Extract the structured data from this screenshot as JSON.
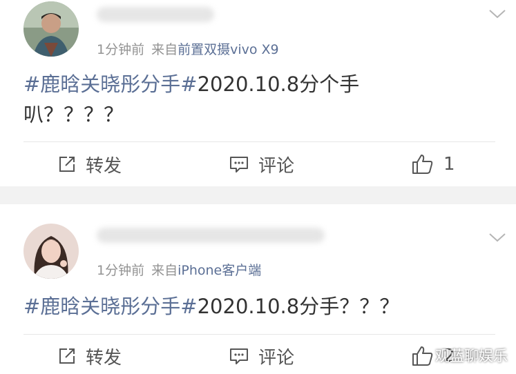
{
  "posts": [
    {
      "time": "1分钟前",
      "source_prefix": "来自",
      "source": "前置双摄vivo X9",
      "hashtag": "#鹿晗关晓彤分手#",
      "text_line1": "2020.10.8分个手",
      "text_line2": "叭？？？？",
      "forward_label": "转发",
      "comment_label": "评论",
      "like_count": "1"
    },
    {
      "time": "1分钟前",
      "source_prefix": "来自",
      "source": "iPhone客户端",
      "hashtag": "#鹿晗关晓彤分手#",
      "text": "2020.10.8分手？？？",
      "forward_label": "转发",
      "comment_label": "评论",
      "like_count": "2"
    }
  ],
  "watermark": "观蓝聊娱乐",
  "colors": {
    "link": "#5b6f95",
    "meta": "#939393",
    "text": "#333333",
    "separator": "#f2f2f2"
  },
  "icons": [
    "chevron-down-icon",
    "share-icon",
    "comment-icon",
    "thumbs-up-icon"
  ]
}
